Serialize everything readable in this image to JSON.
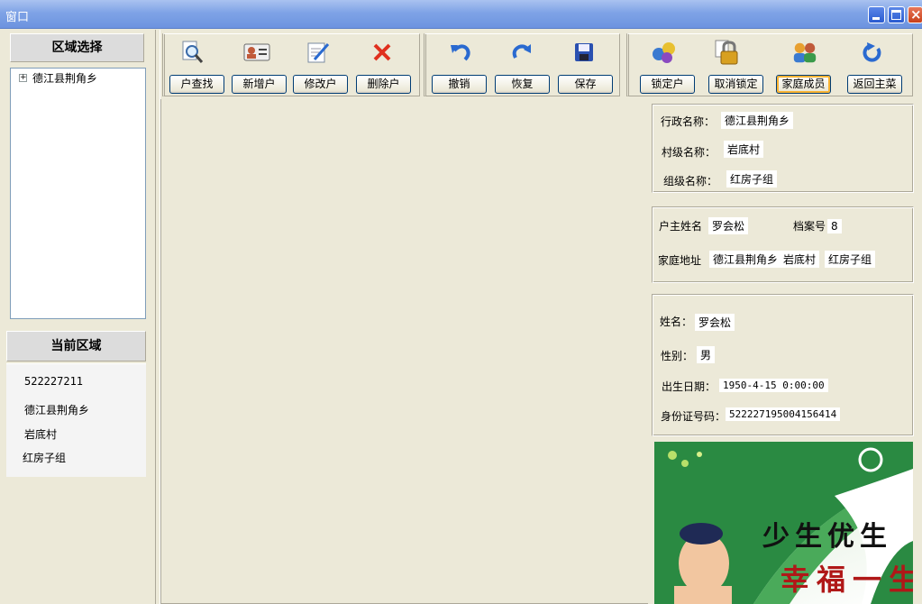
{
  "window": {
    "title": "窗口"
  },
  "left": {
    "region_select_title": "区域选择",
    "tree_root": "德江县荆角乡",
    "current_region_title": "当前区域",
    "region_code": "522227211",
    "region_township": "德江县荆角乡",
    "region_village": "岩底村",
    "region_group": "红房子组"
  },
  "toolbar": {
    "find_label": "户查找",
    "add_label": "新增户",
    "edit_label": "修改户",
    "delete_label": "删除户",
    "undo_label": "撤销",
    "redo_label": "恢复",
    "save_label": "保存",
    "lock_label": "锁定户",
    "unlock_label": "取消锁定",
    "family_label": "家庭成员",
    "back_label": "返回主菜"
  },
  "admin": {
    "admin_name_label": "行政名称：",
    "admin_name_value": "德江县荆角乡",
    "village_label": "村级名称：",
    "village_value": "岩底村",
    "group_label": "组级名称：",
    "group_value": "红房子组"
  },
  "household": {
    "head_label": "户主姓名",
    "head_value": "罗会松",
    "archive_label": "档案号",
    "archive_value": "8",
    "address_label": "家庭地址",
    "address_township": "德江县荆角乡",
    "address_village": "岩底村",
    "address_group": "红房子组"
  },
  "person": {
    "name_label": "姓名：",
    "name_value": "罗会松",
    "gender_label": "性别：",
    "gender_value": "男",
    "birth_label": "出生日期：",
    "birth_value": "1950-4-15 0:00:00",
    "id_label": "身份证号码：",
    "id_value": "522227195004156414"
  },
  "poster": {
    "line1": "少生优生",
    "line2": "幸福一生"
  }
}
